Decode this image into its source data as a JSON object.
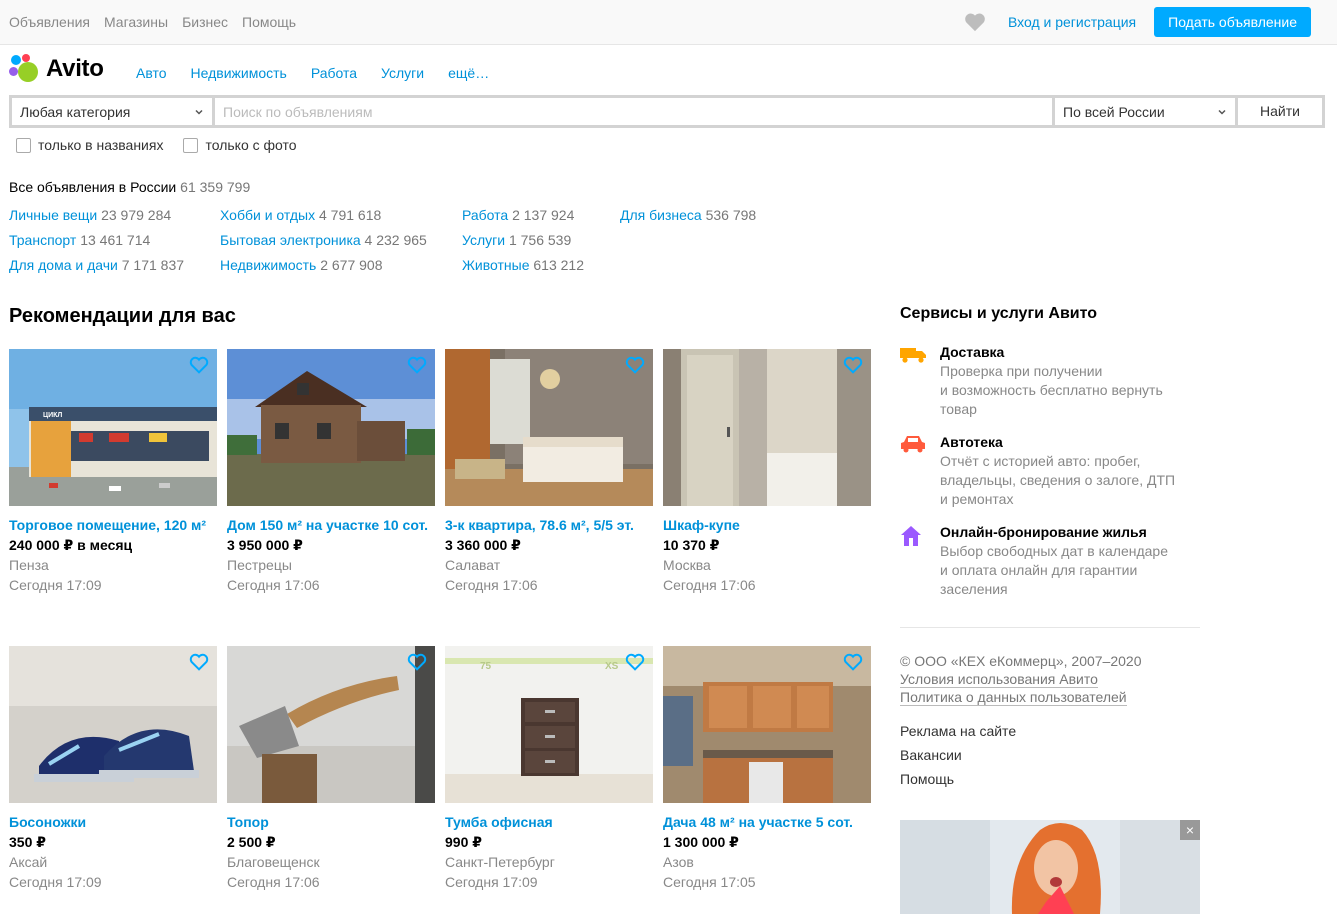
{
  "topbar": {
    "nav": [
      "Объявления",
      "Магазины",
      "Бизнес",
      "Помощь"
    ],
    "login": "Вход и регистрация",
    "post_button": "Подать объявление"
  },
  "logo": {
    "text": "Avito"
  },
  "catnav": [
    "Авто",
    "Недвижимость",
    "Работа",
    "Услуги",
    "ещё…"
  ],
  "search": {
    "category": "Любая категория",
    "placeholder": "Поиск по объявлениям",
    "region": "По всей России",
    "find": "Найти"
  },
  "filters": {
    "titles_only": "только в названиях",
    "with_photo": "только с фото"
  },
  "total": {
    "label": "Все объявления в России",
    "count": "61 359 799"
  },
  "categories": [
    [
      {
        "name": "Личные вещи",
        "count": "23 979 284"
      },
      {
        "name": "Транспорт",
        "count": "13 461 714"
      },
      {
        "name": "Для дома и дачи",
        "count": "7 171 837"
      }
    ],
    [
      {
        "name": "Хобби и отдых",
        "count": "4 791 618"
      },
      {
        "name": "Бытовая электроника",
        "count": "4 232 965"
      },
      {
        "name": "Недвижимость",
        "count": "2 677 908"
      }
    ],
    [
      {
        "name": "Работа",
        "count": "2 137 924"
      },
      {
        "name": "Услуги",
        "count": "1 756 539"
      },
      {
        "name": "Животные",
        "count": "613 212"
      }
    ],
    [
      {
        "name": "Для бизнеса",
        "count": "536 798"
      }
    ]
  ],
  "recommendations": {
    "title": "Рекомендации для вас",
    "items": [
      {
        "title": "Торговое помещение, 120 м²",
        "price": "240 000 ₽ в месяц",
        "city": "Пенза",
        "date": "Сегодня 17:09",
        "sign": "ЦИКЛ"
      },
      {
        "title": "Дом 150 м² на участке 10 сот.",
        "price": "3 950 000 ₽",
        "city": "Пестрецы",
        "date": "Сегодня 17:06"
      },
      {
        "title": "3-к квартира, 78.6 м², 5/5 эт.",
        "price": "3 360 000 ₽",
        "city": "Салават",
        "date": "Сегодня 17:06"
      },
      {
        "title": "Шкаф-купе",
        "price": "10 370 ₽",
        "city": "Москва",
        "date": "Сегодня 17:06"
      },
      {
        "title": "Босоножки",
        "price": "350 ₽",
        "city": "Аксай",
        "date": "Сегодня 17:09"
      },
      {
        "title": "Топор",
        "price": "2 500 ₽",
        "city": "Благовещенск",
        "date": "Сегодня 17:06"
      },
      {
        "title": "Тумба офисная",
        "price": "990 ₽",
        "city": "Санкт-Петербург",
        "date": "Сегодня 17:09",
        "marks": [
          "75",
          "XS"
        ]
      },
      {
        "title": "Дача 48 м² на участке 5 сот.",
        "price": "1 300 000 ₽",
        "city": "Азов",
        "date": "Сегодня 17:05"
      }
    ]
  },
  "services": {
    "title": "Сервисы и услуги Авито",
    "items": [
      {
        "name": "Доставка",
        "desc": [
          "Проверка при получении",
          "и возможность бесплатно вернуть",
          "товар"
        ],
        "icon": "truck-icon",
        "color": "#ffa500"
      },
      {
        "name": "Автотека",
        "desc": [
          "Отчёт с историей авто: пробег,",
          "владельцы, сведения о залоге, ДТП",
          "и ремонтах"
        ],
        "icon": "car-icon",
        "color": "#ff5a3c"
      },
      {
        "name": "Онлайн-бронирование жилья",
        "desc": [
          "Выбор свободных дат в календаре",
          "и оплата онлайн для гарантии",
          "заселения"
        ],
        "icon": "house-icon",
        "color": "#9b59ff"
      }
    ]
  },
  "legal": {
    "copyright": "© ООО «КЕХ еКоммерц», 2007–2020",
    "terms": "Условия использования Авито",
    "privacy": "Политика о данных пользователей"
  },
  "footer_links": [
    "Реклама на сайте",
    "Вакансии",
    "Помощь"
  ],
  "ad": {
    "close": "×"
  },
  "colors": {
    "link": "#0091d9",
    "accent": "#00aaff",
    "fav": "#00aaff"
  }
}
